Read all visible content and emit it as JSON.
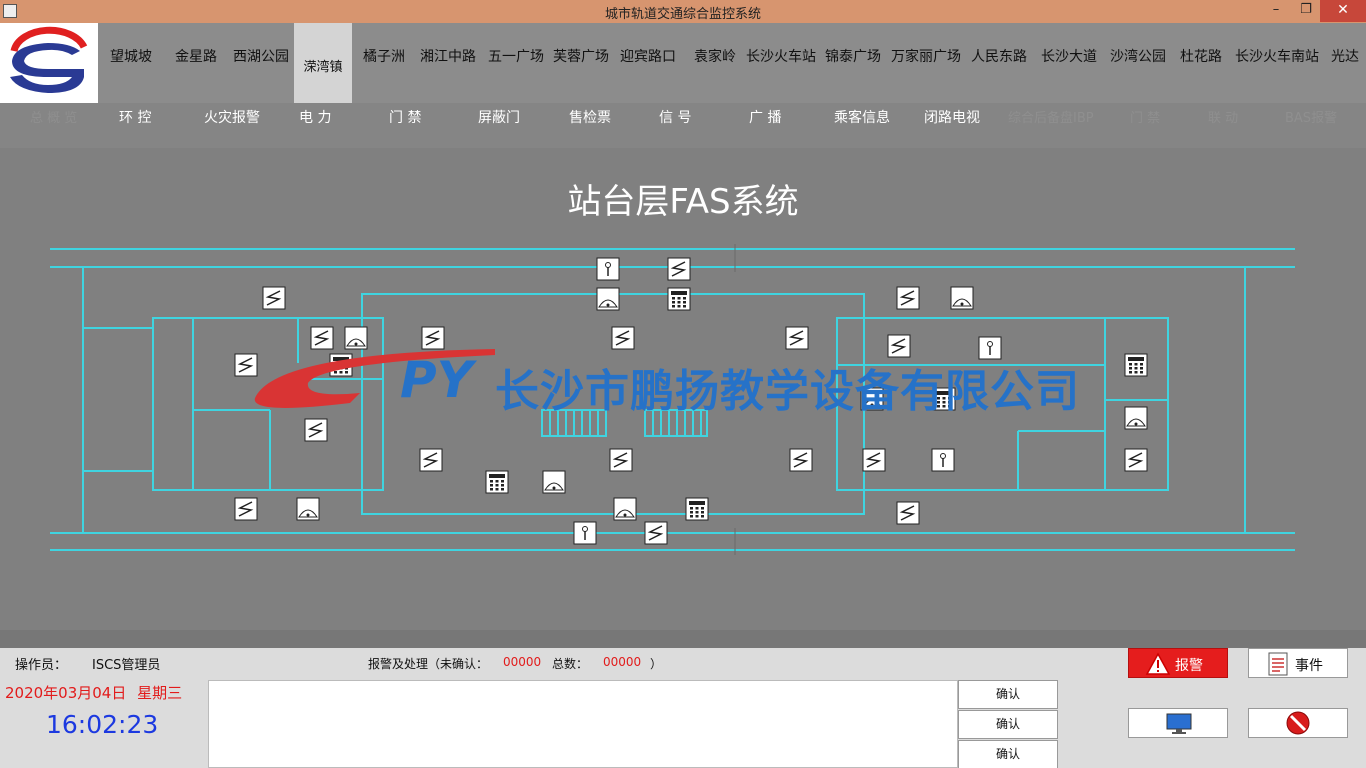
{
  "window": {
    "title": "城市轨道交通综合监控系统",
    "controls": {
      "minimize": "–",
      "restore": "❐",
      "close": "✕"
    }
  },
  "stations": [
    "望城坡",
    "金星路",
    "西湖公园",
    "溁湾镇",
    "橘子洲",
    "湘江中路",
    "五一广场",
    "芙蓉广场",
    "迎宾路口",
    "袁家岭",
    "长沙火车站",
    "锦泰广场",
    "万家丽广场",
    "人民东路",
    "长沙大道",
    "沙湾公园",
    "杜花路",
    "长沙火车南站",
    "光达"
  ],
  "active_station": "溁湾镇",
  "subsystems": [
    "环 控",
    "火灾报警",
    "电 力",
    "门 禁",
    "屏蔽门",
    "售检票",
    "信 号",
    "广 播",
    "乘客信息",
    "闭路电视"
  ],
  "subsystems_ghost": [
    "总 概 览",
    "综合后备盘IBP",
    "门 禁",
    "联 动",
    "BAS报警"
  ],
  "page_title": "站台层FAS系统",
  "watermark": {
    "mark": "PY",
    "company": "长沙市鹏扬教学设备有限公司"
  },
  "status": {
    "operator_label": "操作员：",
    "operator": "ISCS管理员",
    "alarm_label": "报警及处理（未确认：",
    "unconfirmed": "00000",
    "total_label": "总数：",
    "total": "00000",
    "close_paren": "）",
    "date": "2020年03月04日",
    "weekday": "星期三",
    "time": "16:02:23"
  },
  "buttons": {
    "confirm": "确认",
    "alarm": "报警",
    "event": "事件"
  },
  "colors": {
    "title_bar": "#d7956f",
    "wall": "#3fd4e0",
    "alarm_red": "#e21b1b",
    "clock_blue": "#1c39e0"
  },
  "icons": {
    "smoke_detector": "smoke-detector-icon",
    "manual_call_point": "manual-call-point-icon",
    "sounder": "sounder-icon",
    "control_panel": "fire-control-panel-icon",
    "monitor": "monitor-icon",
    "stop": "stop-icon"
  }
}
